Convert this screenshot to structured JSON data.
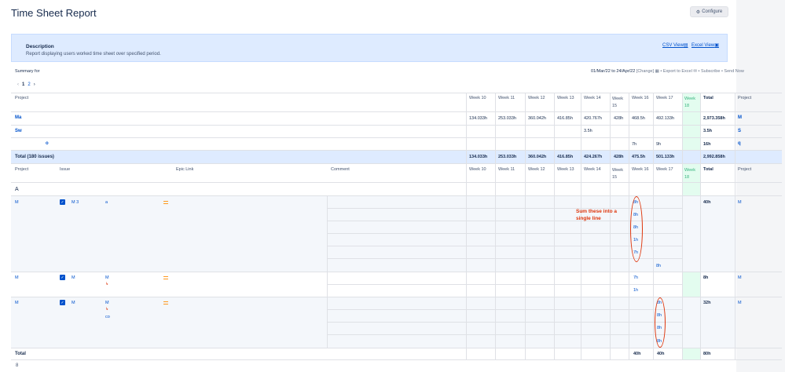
{
  "title": "Time Sheet Report",
  "configure_label": "Configure",
  "description": {
    "title": "Description",
    "text": "Report displaying users worked time sheet over specified period.",
    "csv_link": "CSV View",
    "excel_link": "Excel View"
  },
  "summary_for": "Summary for",
  "range": {
    "dates": "01/Mar/22 to 24/Apr/22",
    "change": "[Change]",
    "export": "• Export to Excel",
    "subscribe": "• Subscribe",
    "send": "• Send Now"
  },
  "pager": {
    "prev": "‹",
    "page1": "1",
    "page2": "2",
    "next": "›"
  },
  "summary_table": {
    "project_header": "Project",
    "weeks": [
      "Week 10",
      "Week 11",
      "Week 12",
      "Week 13",
      "Week 14",
      "Week 15",
      "Week 16",
      "Week 17",
      "Week 18"
    ],
    "total_header": "Total",
    "project_right_header": "Project",
    "rows": [
      {
        "project": "Ma",
        "values": [
          "134.033h",
          "253.033h",
          "360.042h",
          "416.85h",
          "420.767h",
          "428h",
          "468.5h",
          "492.133h",
          ""
        ],
        "total": "2,973.358h",
        "right": "M"
      },
      {
        "project": "Sw",
        "values": [
          "",
          "",
          "",
          "",
          "3.5h",
          "",
          "",
          "",
          ""
        ],
        "total": "3.5h",
        "right": "S"
      },
      {
        "project": "o",
        "values": [
          "",
          "",
          "",
          "",
          "",
          "",
          "7h",
          "9h",
          ""
        ],
        "total": "16h",
        "right": "q"
      }
    ],
    "total_row": {
      "label": "Total (180 issues)",
      "values": [
        "134.033h",
        "253.033h",
        "360.042h",
        "416.85h",
        "424.267h",
        "428h",
        "475.5h",
        "501.133h",
        ""
      ],
      "total": "2,992.858h"
    }
  },
  "detail_table": {
    "headers": {
      "project": "Project",
      "issue": "Issue",
      "epic": "Epic Link",
      "comment": "Comment",
      "total": "Total",
      "project_right": "Project"
    },
    "group_label": "A",
    "group1": {
      "project": "M",
      "issue_key": "M 3",
      "issue_title": "a",
      "entries": [
        "8h",
        "8h",
        "8h",
        "1h",
        "7h"
      ],
      "week17_entry": "8h",
      "total": "40h",
      "right": "M"
    },
    "group2": {
      "project": "M",
      "issue_key": "M",
      "issue_title": "M",
      "entries": [
        "7h",
        "1h"
      ],
      "total": "8h",
      "right": "M"
    },
    "group3": {
      "project": "M",
      "issue_key": "M",
      "issue_title": "M",
      "sub": "co",
      "entries": [
        "8h",
        "8h",
        "8h",
        "8h"
      ],
      "total": "32h",
      "right": "M"
    },
    "total_label": "Total",
    "total_week16": "40h",
    "total_week17": "40h",
    "total_sum": "80h"
  },
  "annotation": "Sum these into a\nsingle line",
  "footer_mark": "8",
  "colors": {
    "link": "#0052cc",
    "annotation": "#de350b",
    "week18": "#e3fcef",
    "description_bg": "#deebff"
  },
  "icons": [
    "gear-icon",
    "csv-icon",
    "excel-icon",
    "export-icon",
    "subscribe-icon",
    "checkbox-icon",
    "priority-medium-icon",
    "subtask-arrow-icon"
  ]
}
